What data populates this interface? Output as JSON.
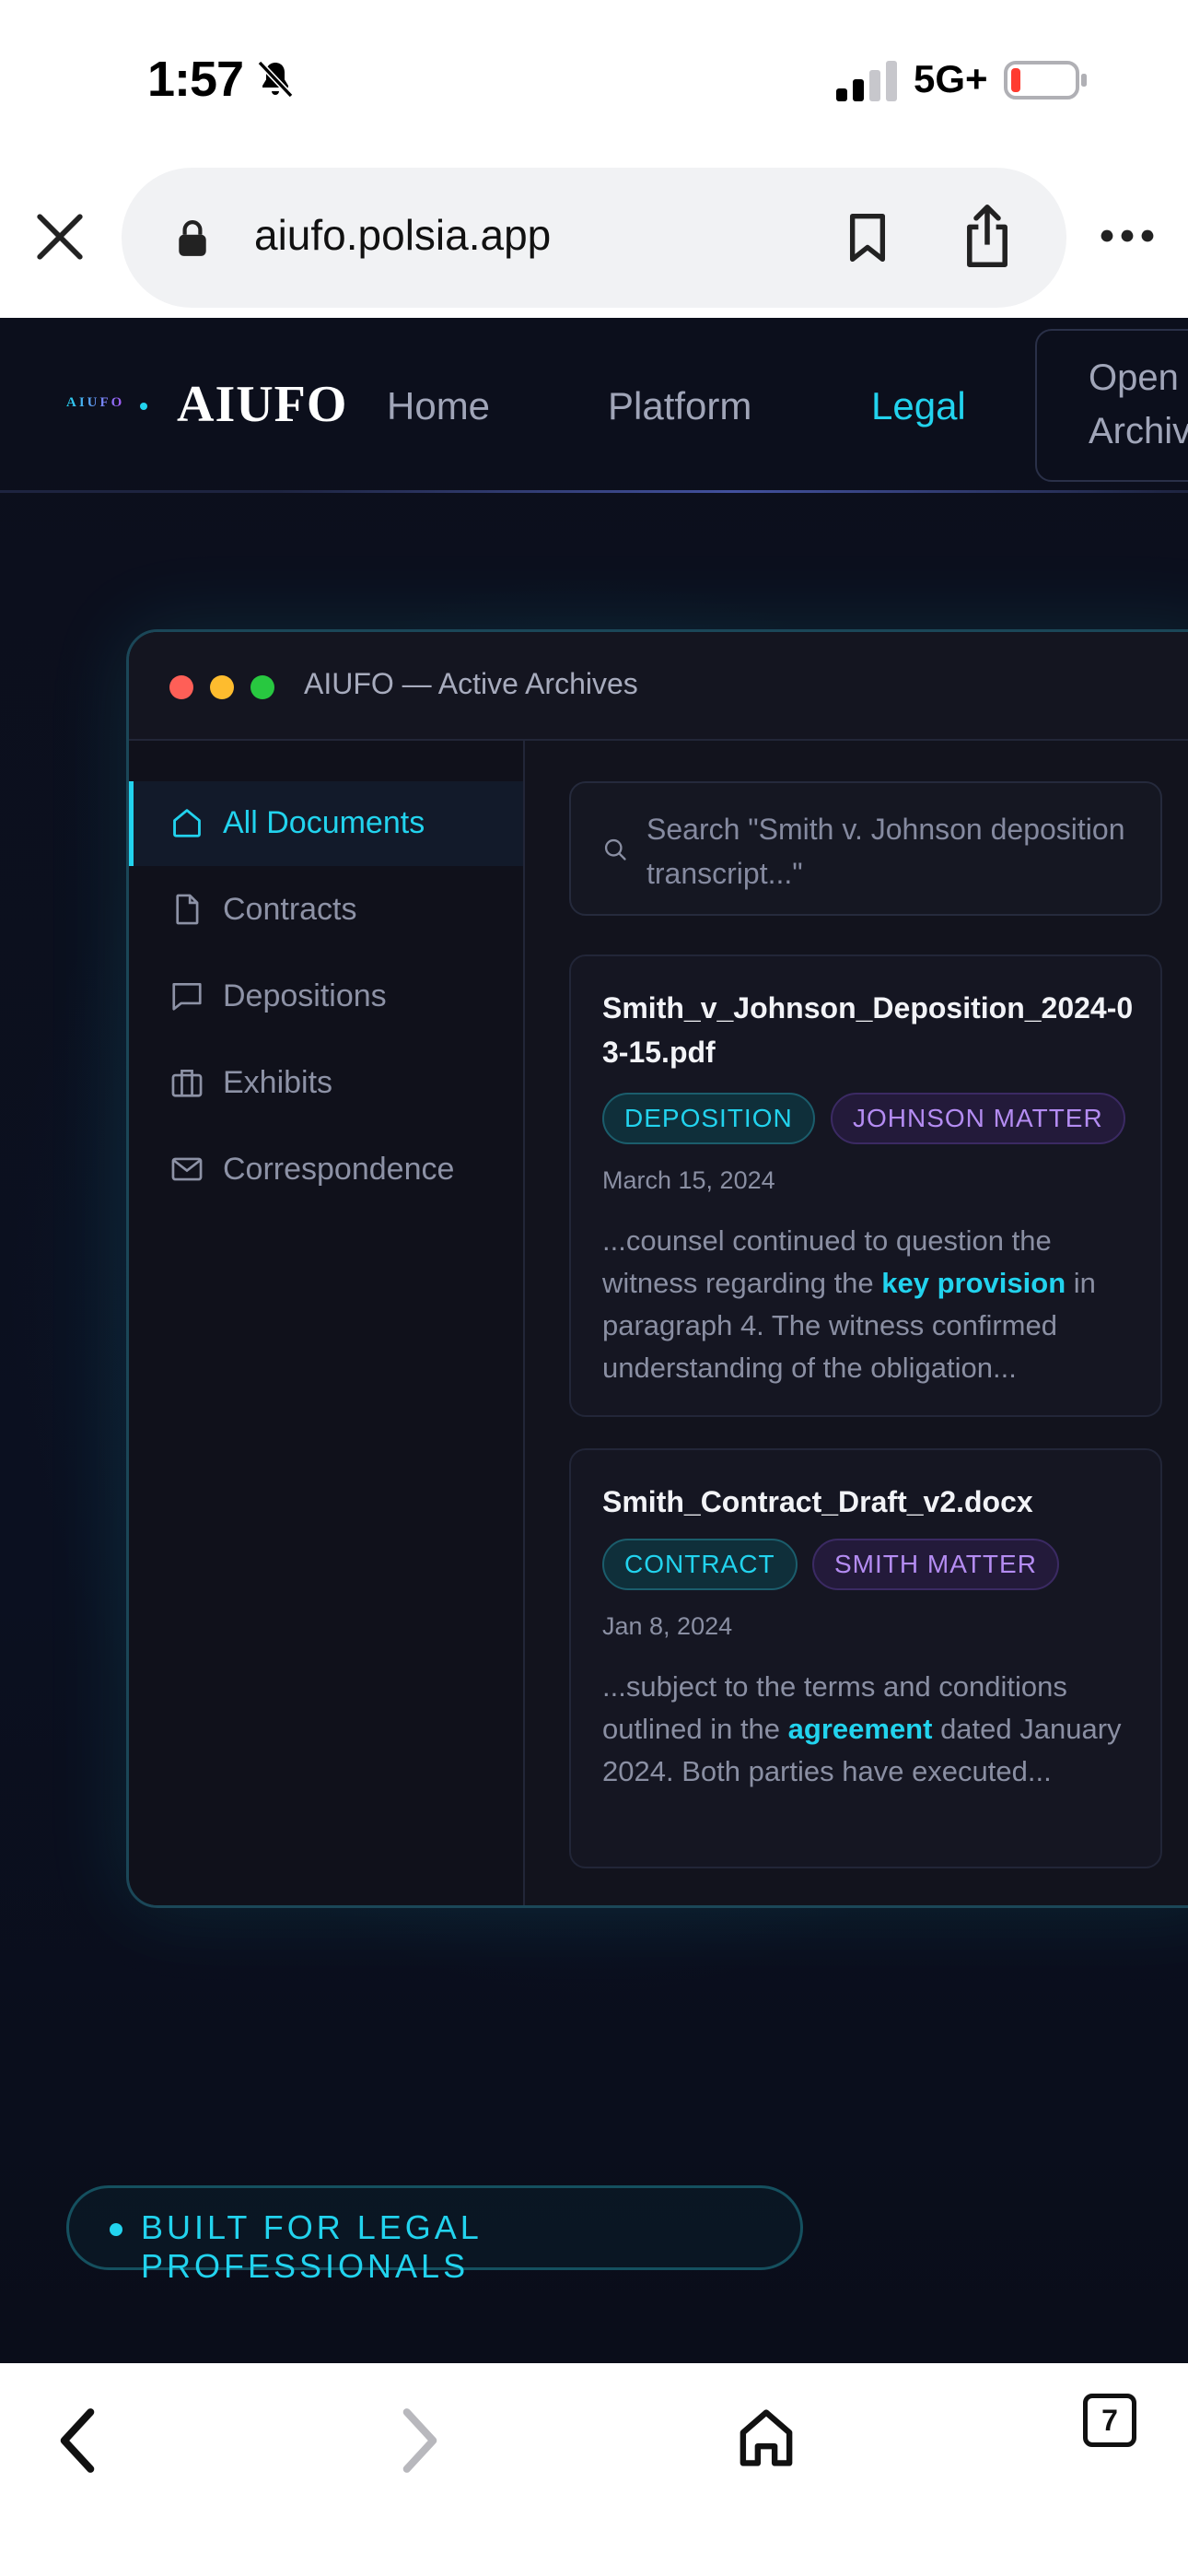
{
  "status_bar": {
    "time": "1:57",
    "network": "5G+",
    "icons": [
      "bell-slash-icon",
      "signal-icon",
      "battery-icon"
    ]
  },
  "browser": {
    "url": "aiufo.polsia.app",
    "tabs_count": "7",
    "icons": [
      "close-icon",
      "lock-icon",
      "bookmark-icon",
      "share-icon",
      "more-icon",
      "back-icon",
      "forward-icon",
      "home-icon"
    ]
  },
  "nav": {
    "logo_mini": "AIUFO",
    "logo": "AIUFO",
    "links": [
      {
        "label": "Home",
        "active": false
      },
      {
        "label": "Platform",
        "active": false
      },
      {
        "label": "Legal",
        "active": true
      }
    ],
    "open_button": "Open\nArchive"
  },
  "window": {
    "title": "AIUFO — Active Archives",
    "sidebar": [
      {
        "label": "All Documents",
        "icon": "home-icon",
        "active": true
      },
      {
        "label": "Contracts",
        "icon": "file-icon",
        "active": false
      },
      {
        "label": "Depositions",
        "icon": "message-icon",
        "active": false
      },
      {
        "label": "Exhibits",
        "icon": "briefcase-icon",
        "active": false
      },
      {
        "label": "Correspondence",
        "icon": "mail-icon",
        "active": false
      }
    ],
    "search_placeholder": "Search \"Smith v. Johnson deposition transcript...\"",
    "results": [
      {
        "filename": "Smith_v_Johnson_Deposition_2024-03-15.pdf",
        "tags": [
          "DEPOSITION",
          "JOHNSON MATTER"
        ],
        "date": "March 15, 2024",
        "snippet_before": "...counsel continued to question the witness regarding the ",
        "snippet_highlight": "key provision",
        "snippet_after": " in paragraph 4. The witness confirmed understanding of the obligation..."
      },
      {
        "filename": "Smith_Contract_Draft_v2.docx",
        "tags": [
          "CONTRACT",
          "SMITH MATTER"
        ],
        "date": "Jan 8, 2024",
        "snippet_before": "...subject to the terms and conditions outlined in the ",
        "snippet_highlight": "agreement",
        "snippet_after": " dated January 2024. Both parties have executed..."
      }
    ]
  },
  "badge": "BUILT FOR LEGAL PROFESSIONALS",
  "colors": {
    "accent": "#22d3ee",
    "purple": "#b48cf2",
    "background": "#0c0f1c"
  }
}
